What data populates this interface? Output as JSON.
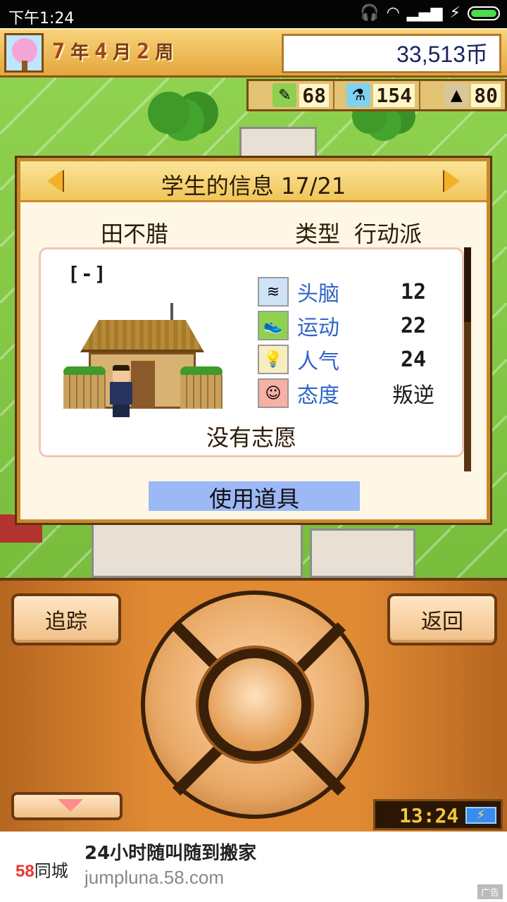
{
  "status_bar": {
    "time": "下午1:24"
  },
  "top_bar": {
    "year": "7",
    "year_unit": "年",
    "month": "4",
    "month_unit": "月",
    "week": "2",
    "week_unit": "周",
    "money": "33,513币"
  },
  "resources": [
    {
      "icon": "pencil-icon",
      "value": "68"
    },
    {
      "icon": "flask-icon",
      "value": "154"
    },
    {
      "icon": "weight-icon",
      "value": "80"
    }
  ],
  "panel": {
    "title": "学生的信息 17/21",
    "student_name": "田不腊",
    "type_label": "类型",
    "type_value": "行动派",
    "club_tag": "[-]",
    "stats": [
      {
        "icon": "brain-icon",
        "label": "头脑",
        "value": "12"
      },
      {
        "icon": "sneaker-icon",
        "label": "运动",
        "value": "22"
      },
      {
        "icon": "lightbulb-icon",
        "label": "人气",
        "value": "24"
      },
      {
        "icon": "face-icon",
        "label": "态度",
        "value": "叛逆"
      }
    ],
    "wish": "没有志愿",
    "use_item": "使用道具"
  },
  "controller": {
    "track_label": "追踪",
    "back_label": "返回",
    "clock": "13:24"
  },
  "ad": {
    "logo_num": "58",
    "logo_text": "同城",
    "title": "24小时随叫随到搬家",
    "url": "jumpluna.58.com",
    "tag": "广告"
  },
  "colors": {
    "accent_gold": "#f0c55a",
    "stat_label_blue": "#2f64c8",
    "use_item_blue": "#9db8f7",
    "controller_orange": "#e08a34"
  }
}
